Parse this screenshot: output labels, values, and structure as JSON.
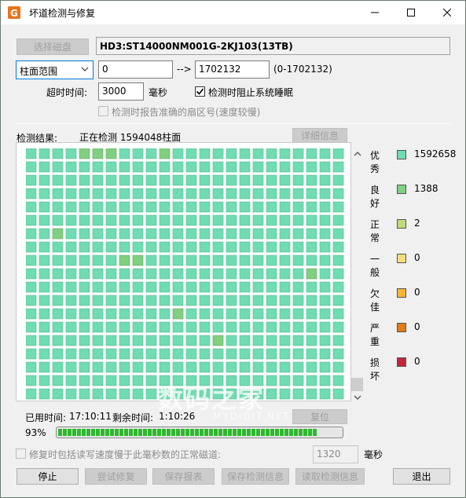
{
  "window": {
    "title": "坏道检测与修复"
  },
  "disk": {
    "select_button": "选择磁盘",
    "name": "HD3:ST14000NM001G-2KJ103(13TB)"
  },
  "range": {
    "mode": "柱面范围",
    "start": "0",
    "arrow": "-->",
    "end": "1702132",
    "hint": "(0-1702132)"
  },
  "timeout": {
    "label": "超时时间:",
    "value": "3000",
    "unit": "毫秒"
  },
  "options": {
    "prevent_sleep": {
      "label": "检测时阻止系统睡眠",
      "checked": true
    },
    "report_sector": {
      "label": "检测时报告准确的扇区号(速度较慢)",
      "checked": false
    }
  },
  "result": {
    "label": "检测结果:",
    "status": "正在检测 1594048柱面",
    "details_button": "详细信息"
  },
  "grid": {
    "rows": 22,
    "cols": 24,
    "filled_in_last_row": 4,
    "good_cells": [
      [
        0,
        4
      ],
      [
        0,
        5
      ],
      [
        0,
        6
      ],
      [
        0,
        10
      ],
      [
        6,
        2
      ],
      [
        8,
        7
      ],
      [
        8,
        8
      ],
      [
        9,
        21
      ],
      [
        12,
        11
      ],
      [
        14,
        14
      ]
    ],
    "moderate_cells": []
  },
  "legend": [
    {
      "name": "优秀",
      "count": "1592658",
      "color": "#6fdcb1"
    },
    {
      "name": "良好",
      "count": "1388",
      "color": "#7fd07f"
    },
    {
      "name": "正常",
      "count": "2",
      "color": "#bcdc7a"
    },
    {
      "name": "一般",
      "count": "0",
      "color": "#f5dc7c"
    },
    {
      "name": "欠佳",
      "count": "0",
      "color": "#f5b43a"
    },
    {
      "name": "严重",
      "count": "0",
      "color": "#e07b1a"
    },
    {
      "name": "损坏",
      "count": "0",
      "color": "#c0283a"
    }
  ],
  "time": {
    "elapsed_label": "已用时间:",
    "elapsed": "17:10:11",
    "remain_label": "剩余时间:",
    "remain": "1:10:26",
    "reset_button": "复位"
  },
  "progress": {
    "percent_text": "93%",
    "fraction": 0.93
  },
  "repair_option": {
    "label": "修复时包括读写速度慢于此毫秒数的正常磁道:",
    "value": "1320",
    "unit": "毫秒"
  },
  "buttons": {
    "stop": "停止",
    "try_repair": "尝试修复",
    "save_report": "保存报表",
    "save_info": "保存检测信息",
    "load_info": "读取检测信息",
    "exit": "退出"
  },
  "watermark": {
    "main": "数码之家",
    "sub": "MYDIGIT.NET"
  }
}
